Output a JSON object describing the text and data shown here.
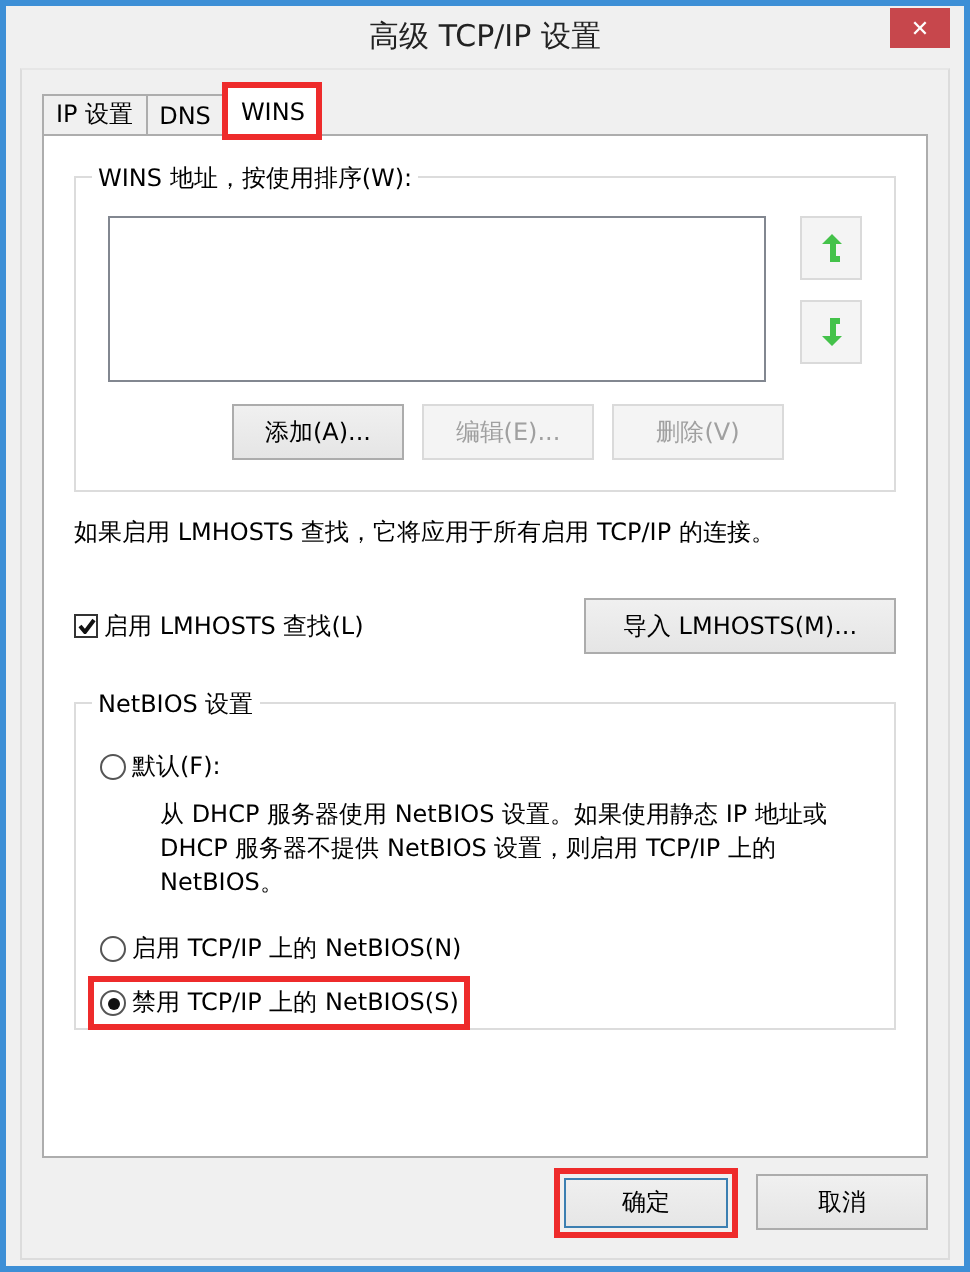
{
  "window": {
    "title": "高级 TCP/IP 设置",
    "close": "✕"
  },
  "tabs": [
    {
      "label": "IP 设置",
      "selected": false,
      "highlighted": false
    },
    {
      "label": "DNS",
      "selected": false,
      "highlighted": false
    },
    {
      "label": "WINS",
      "selected": true,
      "highlighted": true
    }
  ],
  "wins_group": {
    "title": "WINS 地址，按使用排序(W):",
    "buttons": [
      {
        "label": "添加(A)...",
        "disabled": false
      },
      {
        "label": "编辑(E)...",
        "disabled": true
      },
      {
        "label": "删除(V)",
        "disabled": true
      }
    ]
  },
  "lmhosts_note": "如果启用 LMHOSTS 查找，它将应用于所有启用 TCP/IP 的连接。",
  "lmhosts_checkbox": {
    "label": "启用 LMHOSTS 查找(L)",
    "checked": true
  },
  "import_button": "导入 LMHOSTS(M)...",
  "netbios_group": {
    "title": "NetBIOS 设置",
    "options": [
      {
        "label": "默认(F):",
        "selected": false,
        "highlighted": false,
        "description": "从 DHCP 服务器使用 NetBIOS 设置。如果使用静态 IP 地址或 DHCP 服务器不提供 NetBIOS 设置，则启用 TCP/IP 上的 NetBIOS。"
      },
      {
        "label": "启用 TCP/IP 上的 NetBIOS(N)",
        "selected": false,
        "highlighted": false
      },
      {
        "label": "禁用 TCP/IP 上的 NetBIOS(S)",
        "selected": true,
        "highlighted": true
      }
    ]
  },
  "footer_buttons": [
    {
      "label": "确定",
      "default": true,
      "highlighted": true
    },
    {
      "label": "取消",
      "default": false,
      "highlighted": false
    }
  ]
}
